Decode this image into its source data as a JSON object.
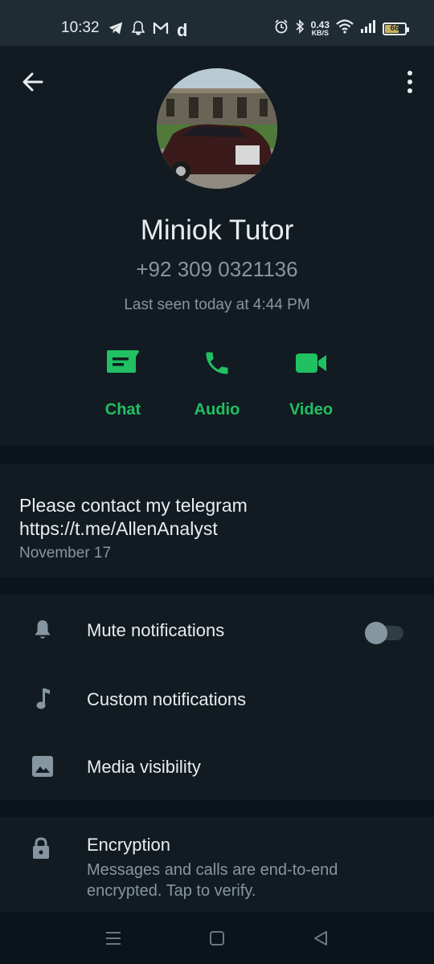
{
  "status_bar": {
    "time": "10:32",
    "net_speed": "0.43",
    "net_unit": "KB/S",
    "battery": "66",
    "icons": [
      "telegram-icon",
      "bell-icon",
      "gmail-icon",
      "d-app-icon",
      "alarm-icon",
      "bluetooth-icon",
      "wifi-icon",
      "signal-icon",
      "battery-icon"
    ],
    "d_app_letter": "d"
  },
  "profile": {
    "name": "Miniok Tutor",
    "phone": "+92 309 0321136",
    "last_seen": "Last seen today at 4:44 PM",
    "actions": [
      {
        "label": "Chat",
        "icon": "chat-icon"
      },
      {
        "label": "Audio",
        "icon": "phone-icon"
      },
      {
        "label": "Video",
        "icon": "video-icon"
      }
    ]
  },
  "about": {
    "text_line1": "Please contact my telegram",
    "text_line2": "https://t.me/AllenAnalyst",
    "date": "November 17"
  },
  "settings": {
    "mute_label": "Mute notifications",
    "mute_on": false,
    "custom_label": "Custom notifications",
    "media_label": "Media visibility"
  },
  "encryption": {
    "title": "Encryption",
    "description": "Messages and calls are end-to-end encrypted. Tap to verify."
  },
  "colors": {
    "background": "#0b141a",
    "surface": "#111b21",
    "accent": "#21c063",
    "secondary_text": "#8696a0",
    "primary_text": "#e9edef"
  }
}
